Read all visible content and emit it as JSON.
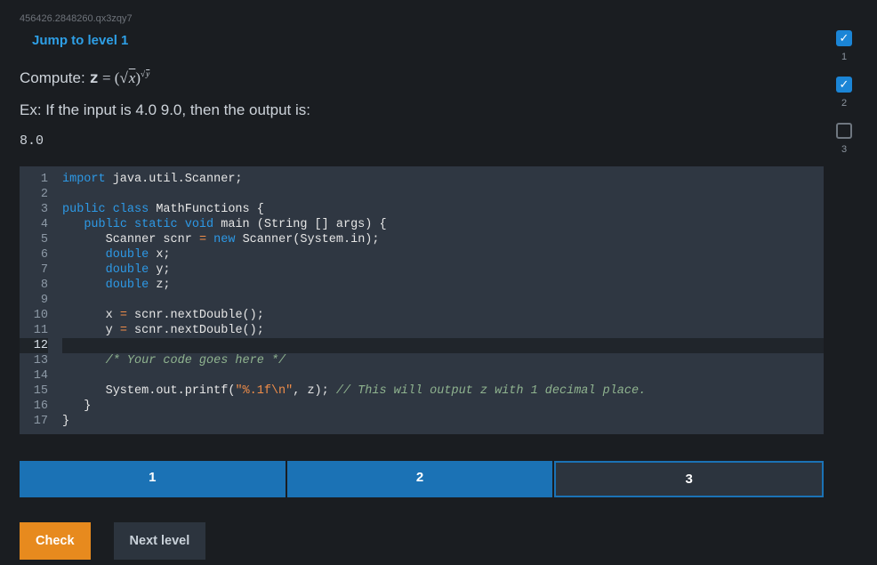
{
  "breadcrumb": "456426.2848260.qx3zqy7",
  "jump_link": "Jump to level 1",
  "prompt_prefix": "Compute: ",
  "prompt_math_var": "z",
  "prompt_math_eq": " = ",
  "prompt_math_base_lparen": "(",
  "prompt_math_base_radical": "√",
  "prompt_math_base_x": "x",
  "prompt_math_base_rparen": ")",
  "prompt_math_exp_radical": "√",
  "prompt_math_exp_y": "y",
  "example_text": "Ex: If the input is 4.0 9.0, then the output is:",
  "example_output": "8.0",
  "code_lines": [
    {
      "n": 1,
      "tokens": [
        {
          "c": "kw-import",
          "t": "import"
        },
        {
          "c": "plain",
          "t": " java.util.Scanner;"
        }
      ]
    },
    {
      "n": 2,
      "tokens": []
    },
    {
      "n": 3,
      "tokens": [
        {
          "c": "kw-mod",
          "t": "public class"
        },
        {
          "c": "plain",
          "t": " MathFunctions {"
        }
      ]
    },
    {
      "n": 4,
      "tokens": [
        {
          "c": "plain",
          "t": "   "
        },
        {
          "c": "kw-mod",
          "t": "public static void"
        },
        {
          "c": "plain",
          "t": " main (String [] args) {"
        }
      ]
    },
    {
      "n": 5,
      "tokens": [
        {
          "c": "plain",
          "t": "      Scanner scnr "
        },
        {
          "c": "op",
          "t": "="
        },
        {
          "c": "plain",
          "t": " "
        },
        {
          "c": "kw-new",
          "t": "new"
        },
        {
          "c": "plain",
          "t": " Scanner(System.in);"
        }
      ]
    },
    {
      "n": 6,
      "tokens": [
        {
          "c": "plain",
          "t": "      "
        },
        {
          "c": "kw-type",
          "t": "double"
        },
        {
          "c": "plain",
          "t": " x;"
        }
      ]
    },
    {
      "n": 7,
      "tokens": [
        {
          "c": "plain",
          "t": "      "
        },
        {
          "c": "kw-type",
          "t": "double"
        },
        {
          "c": "plain",
          "t": " y;"
        }
      ]
    },
    {
      "n": 8,
      "tokens": [
        {
          "c": "plain",
          "t": "      "
        },
        {
          "c": "kw-type",
          "t": "double"
        },
        {
          "c": "plain",
          "t": " z;"
        }
      ]
    },
    {
      "n": 9,
      "tokens": []
    },
    {
      "n": 10,
      "tokens": [
        {
          "c": "plain",
          "t": "      x "
        },
        {
          "c": "op",
          "t": "="
        },
        {
          "c": "plain",
          "t": " scnr.nextDouble();"
        }
      ]
    },
    {
      "n": 11,
      "tokens": [
        {
          "c": "plain",
          "t": "      y "
        },
        {
          "c": "op",
          "t": "="
        },
        {
          "c": "plain",
          "t": " scnr.nextDouble();"
        }
      ]
    },
    {
      "n": 12,
      "tokens": [],
      "active": true
    },
    {
      "n": 13,
      "tokens": [
        {
          "c": "plain",
          "t": "      "
        },
        {
          "c": "comment",
          "t": "/* Your code goes here */"
        }
      ]
    },
    {
      "n": 14,
      "tokens": []
    },
    {
      "n": 15,
      "tokens": [
        {
          "c": "plain",
          "t": "      System.out.printf("
        },
        {
          "c": "string",
          "t": "\"%.1f\\n\""
        },
        {
          "c": "plain",
          "t": ", z); "
        },
        {
          "c": "comment",
          "t": "// This will output z with 1 decimal place."
        }
      ]
    },
    {
      "n": 16,
      "tokens": [
        {
          "c": "plain",
          "t": "   }"
        }
      ]
    },
    {
      "n": 17,
      "tokens": [
        {
          "c": "plain",
          "t": "}"
        }
      ]
    }
  ],
  "level_tabs": [
    {
      "label": "1",
      "state": "filled"
    },
    {
      "label": "2",
      "state": "filled"
    },
    {
      "label": "3",
      "state": "current"
    }
  ],
  "buttons": {
    "check": "Check",
    "next": "Next level"
  },
  "progress": [
    {
      "label": "1",
      "done": true
    },
    {
      "label": "2",
      "done": true
    },
    {
      "label": "3",
      "done": false
    }
  ]
}
